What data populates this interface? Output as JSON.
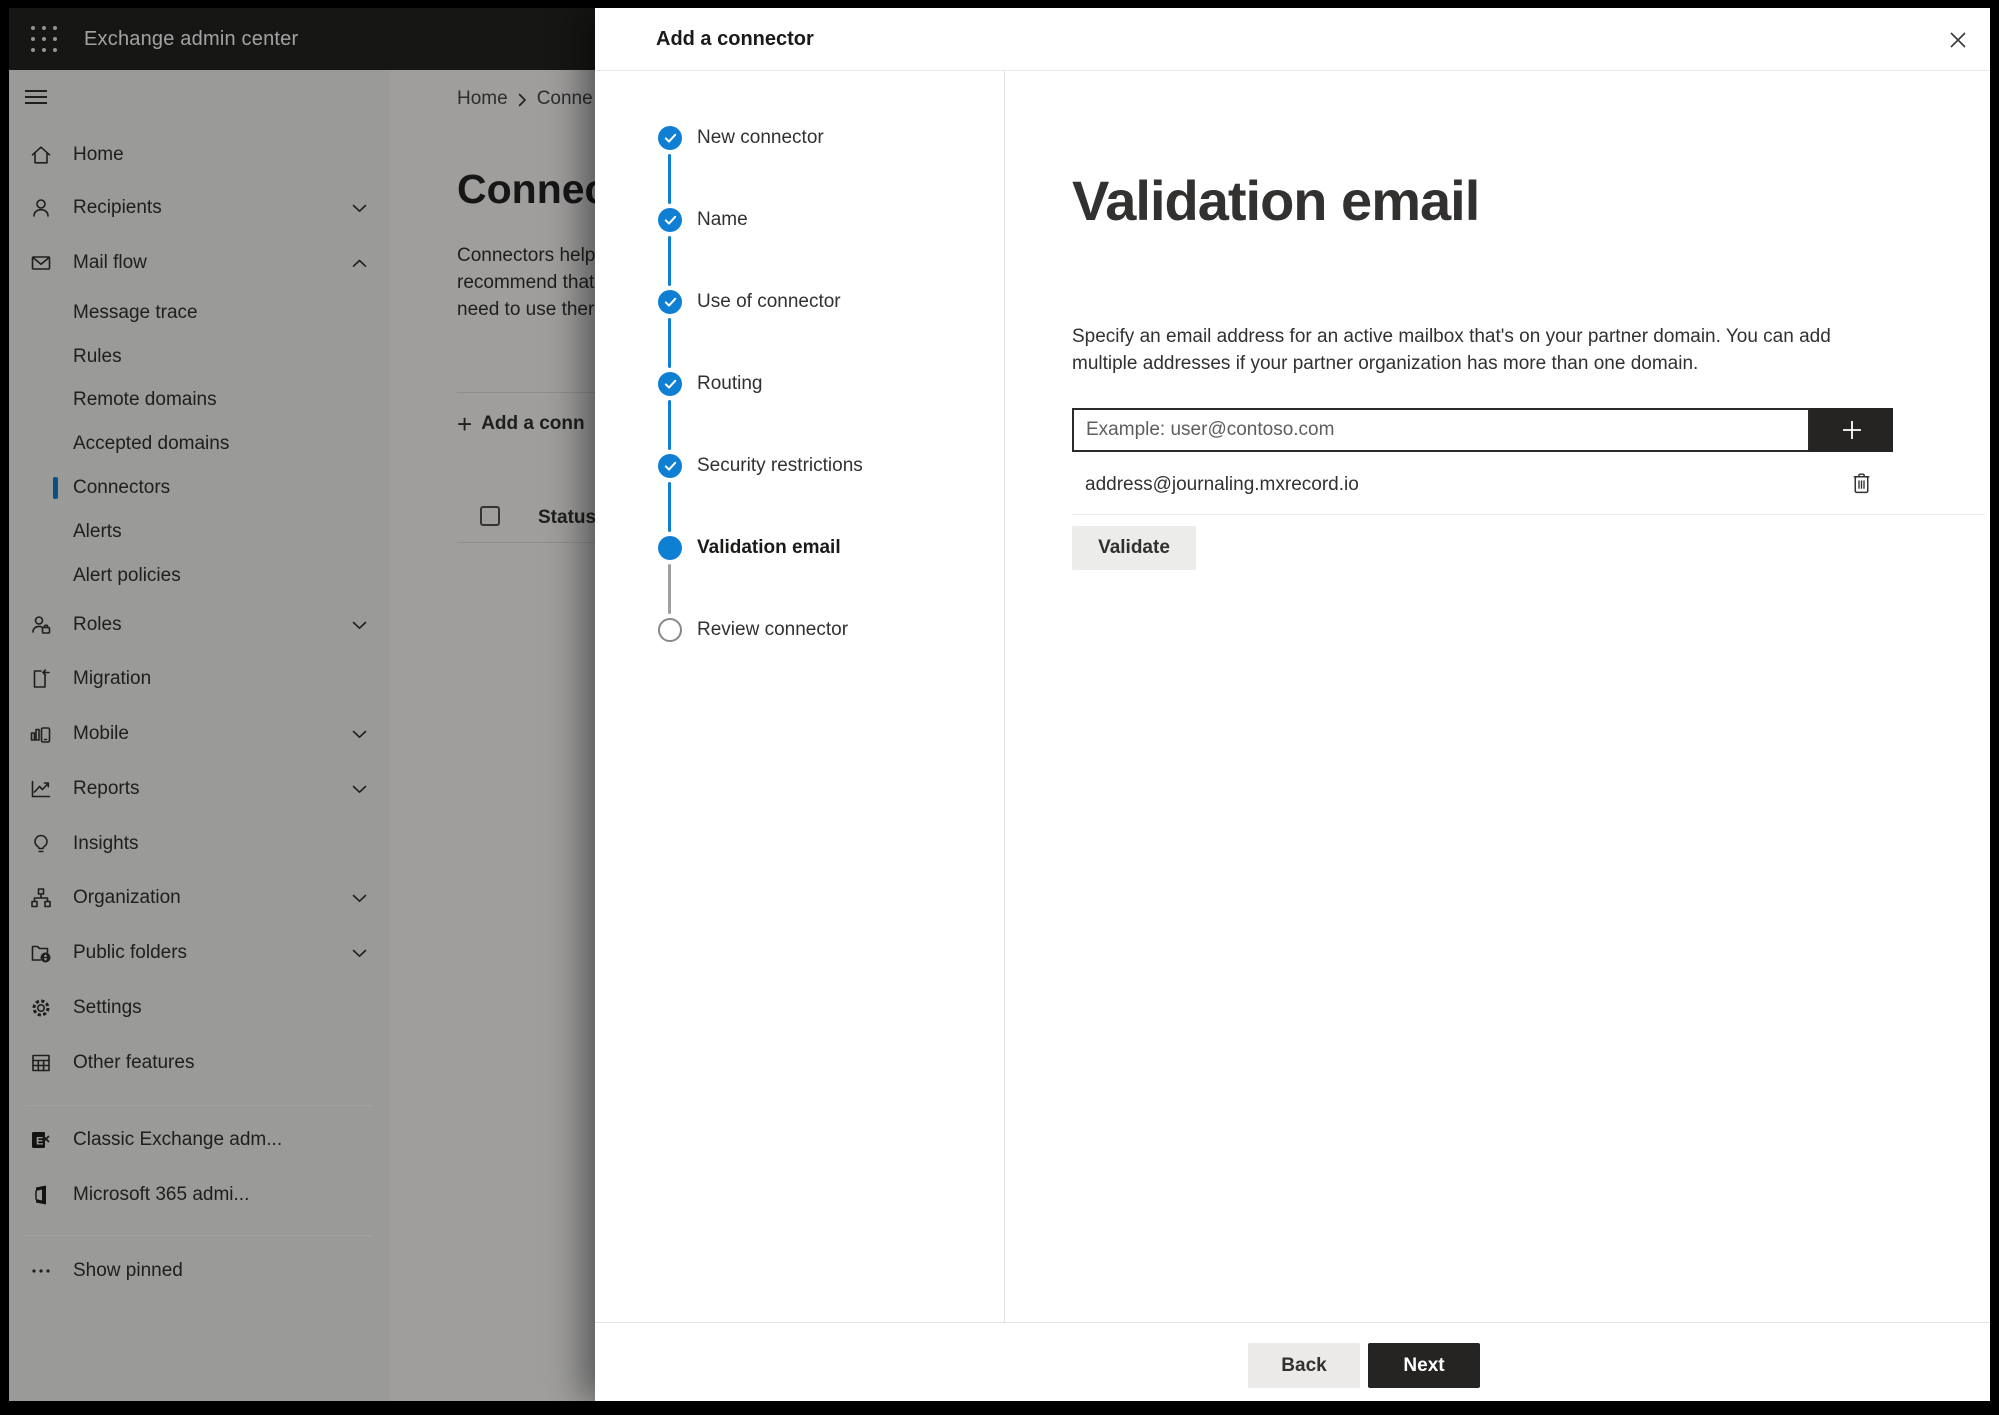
{
  "colors": {
    "accent_blue": "#0f7fd4",
    "primary_button_bg": "#252423",
    "topbar_bg": "#242322",
    "sidebar_bg": "#f3f2f1",
    "selected_item_bar": "#0f7fd4"
  },
  "topbar": {
    "app_title": "Exchange admin center"
  },
  "sidebar": {
    "items": [
      {
        "label": "Home"
      },
      {
        "label": "Recipients",
        "chevron": "down"
      },
      {
        "label": "Mail flow",
        "chevron": "up",
        "expanded": true
      },
      {
        "label": "Roles",
        "chevron": "down"
      },
      {
        "label": "Migration"
      },
      {
        "label": "Mobile",
        "chevron": "down"
      },
      {
        "label": "Reports",
        "chevron": "down"
      },
      {
        "label": "Insights"
      },
      {
        "label": "Organization",
        "chevron": "down"
      },
      {
        "label": "Public folders",
        "chevron": "down"
      },
      {
        "label": "Settings"
      },
      {
        "label": "Other features"
      }
    ],
    "mailflow_children": [
      {
        "label": "Message trace"
      },
      {
        "label": "Rules"
      },
      {
        "label": "Remote domains"
      },
      {
        "label": "Accepted domains"
      },
      {
        "label": "Connectors",
        "selected": true
      },
      {
        "label": "Alerts"
      },
      {
        "label": "Alert policies"
      }
    ],
    "footer_links": [
      {
        "label": "Classic Exchange adm..."
      },
      {
        "label": "Microsoft 365 admi..."
      }
    ],
    "show_pinned": "Show pinned"
  },
  "page": {
    "breadcrumb": {
      "home": "Home",
      "current": "Conne"
    },
    "title": "Connect",
    "intro_lines": [
      "Connectors help",
      "recommend that",
      "need to use ther"
    ],
    "add_button": "Add a conn",
    "status_header": "Status"
  },
  "modal": {
    "title": "Add a connector",
    "steps": [
      {
        "label": "New connector",
        "state": "completed"
      },
      {
        "label": "Name",
        "state": "completed"
      },
      {
        "label": "Use of connector",
        "state": "completed"
      },
      {
        "label": "Routing",
        "state": "completed"
      },
      {
        "label": "Security restrictions",
        "state": "completed"
      },
      {
        "label": "Validation email",
        "state": "current"
      },
      {
        "label": "Review connector",
        "state": "upcoming"
      }
    ],
    "content": {
      "heading": "Validation email",
      "description": "Specify an email address for an active mailbox that's on your partner domain. You can add multiple addresses if your partner organization has more than one domain.",
      "email_placeholder": "Example: user@contoso.com",
      "added_addresses": [
        "address@journaling.mxrecord.io"
      ],
      "validate_button": "Validate"
    },
    "footer": {
      "back_button": "Back",
      "next_button": "Next"
    }
  }
}
